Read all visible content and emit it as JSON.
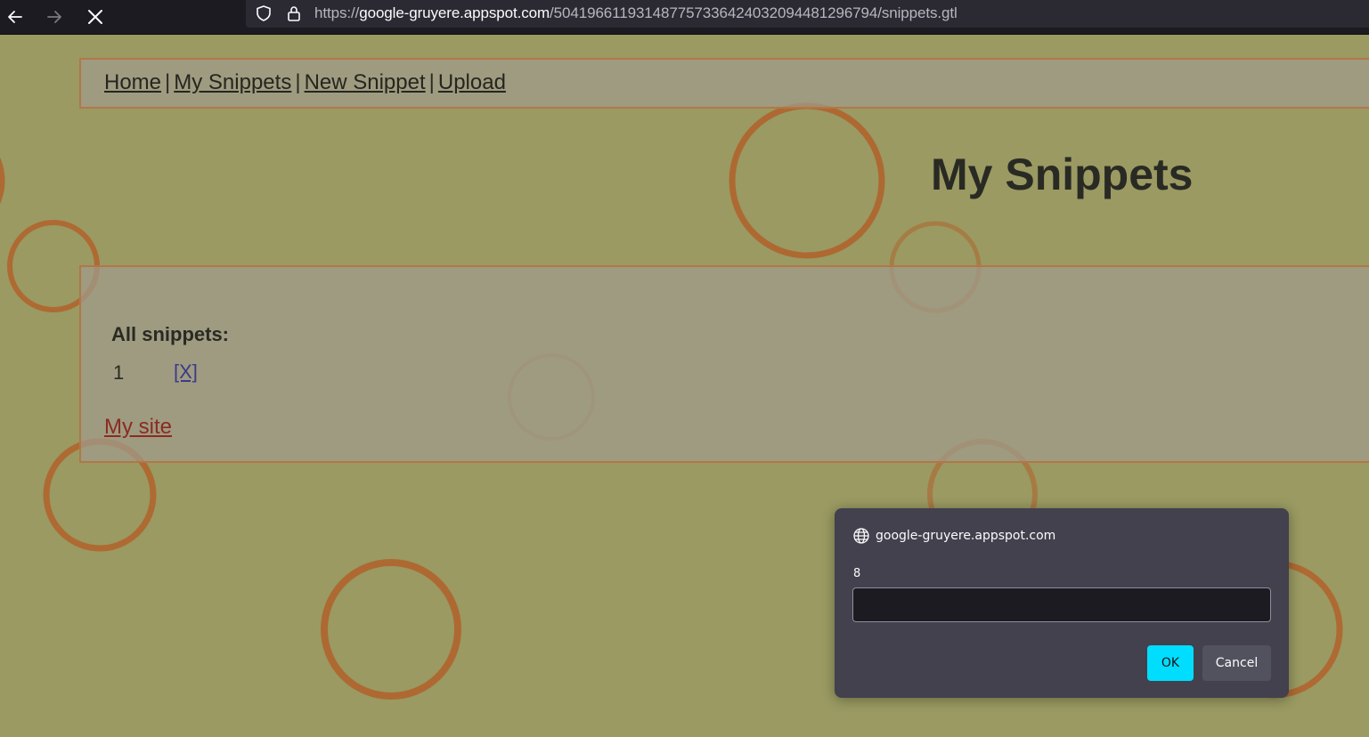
{
  "browser": {
    "url_prefix": "https://",
    "url_host": "google-gruyere.appspot.com",
    "url_path": "/504196611931487757336424032094481296794/snippets.gtl",
    "icons": [
      "back-icon",
      "forward-icon",
      "stop-icon",
      "shield-icon",
      "lock-icon"
    ]
  },
  "menu": {
    "home": "Home",
    "my_snippets": "My Snippets",
    "new_snippet": "New Snippet",
    "upload": "Upload",
    "separator": "|"
  },
  "page": {
    "title": "My Snippets",
    "all_snippets_label": "All snippets:",
    "snippet_number": "1",
    "delete_link": "[X]",
    "my_site_link": "My site"
  },
  "dialog": {
    "origin": "google-gruyere.appspot.com",
    "message": "8",
    "input_value": "",
    "ok_label": "OK",
    "cancel_label": "Cancel"
  },
  "colors": {
    "page_background": "#9a9a62",
    "ring_color": "#b0652e",
    "dialog_background": "#42414d",
    "ok_button": "#00ddff"
  }
}
